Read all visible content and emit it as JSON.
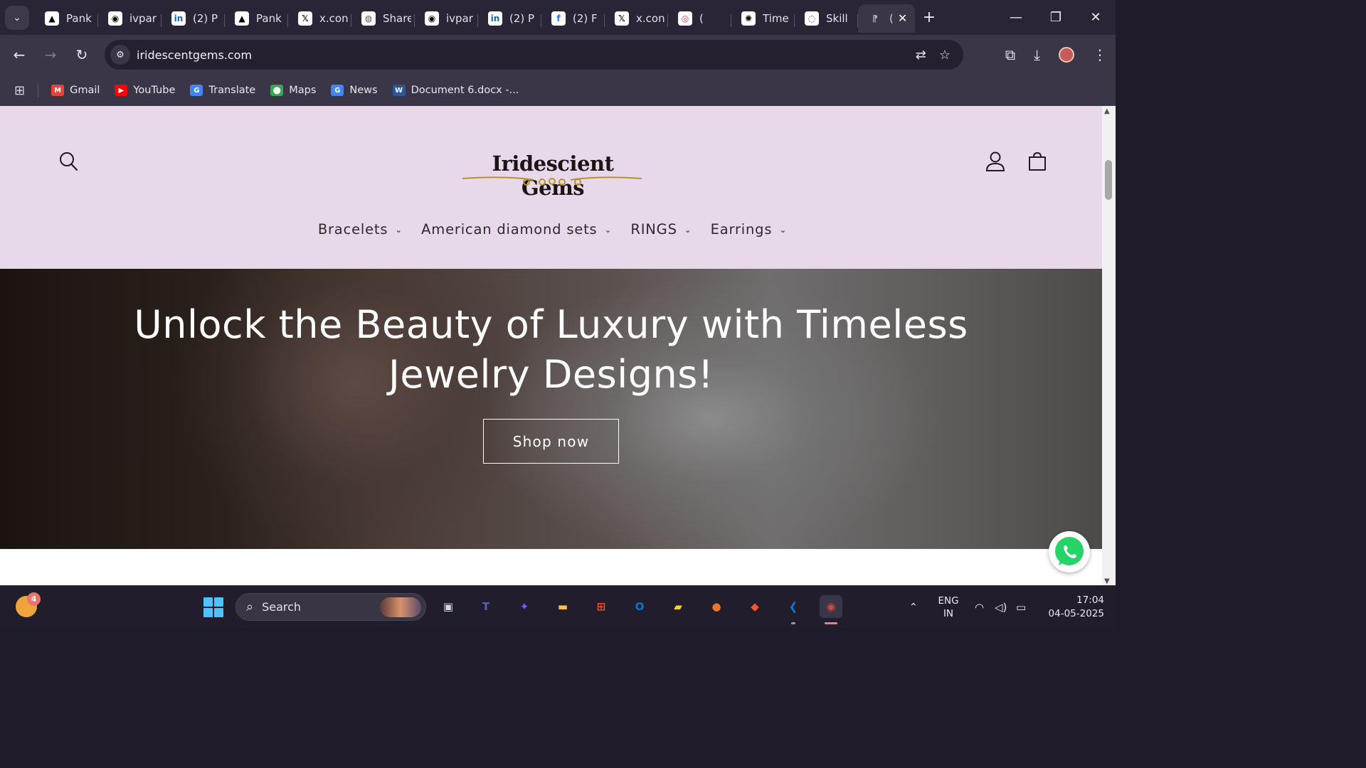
{
  "browser": {
    "tabs": [
      {
        "title": "Pank",
        "icon": "vercel-triangle-icon",
        "fav": "▲",
        "color": "#000000"
      },
      {
        "title": "ivpar",
        "icon": "github-icon",
        "fav": "◉",
        "color": "#000000"
      },
      {
        "title": "(2) P",
        "icon": "linkedin-icon",
        "fav": "in",
        "color": "#0a66c2"
      },
      {
        "title": "Pank",
        "icon": "vercel-triangle-icon",
        "fav": "▲",
        "color": "#000000"
      },
      {
        "title": "x.con",
        "icon": "x-icon",
        "fav": "𝕏",
        "color": "#000000"
      },
      {
        "title": "Share",
        "icon": "globe-icon",
        "fav": "◍",
        "color": "#555555"
      },
      {
        "title": "ivpar",
        "icon": "github-icon",
        "fav": "◉",
        "color": "#000000"
      },
      {
        "title": "(2) P",
        "icon": "linkedin-icon",
        "fav": "in",
        "color": "#0a66c2"
      },
      {
        "title": "(2) F",
        "icon": "facebook-icon",
        "fav": "f",
        "color": "#1877f2"
      },
      {
        "title": "x.con",
        "icon": "x-icon",
        "fav": "𝕏",
        "color": "#000000"
      },
      {
        "title": "(",
        "icon": "instagram-icon",
        "fav": "◎",
        "color": "#e1306c"
      },
      {
        "title": "Time",
        "icon": "chatgpt-icon",
        "fav": "✺",
        "color": "#000000"
      },
      {
        "title": "Skill",
        "icon": "skill-icon",
        "fav": "◌",
        "color": "#444444"
      }
    ],
    "active_tab": {
      "title": "(",
      "icon": "site-favicon-icon"
    },
    "window_controls": {
      "minimize": "—",
      "maximize": "❐",
      "close": "✕"
    },
    "url": "iridescentgems.com",
    "bookmarks": [
      {
        "label": "Gmail",
        "icon": "gmail-icon",
        "glyph": "M",
        "color": "#ea4335"
      },
      {
        "label": "YouTube",
        "icon": "youtube-icon",
        "glyph": "▶",
        "color": "#ff0000"
      },
      {
        "label": "Translate",
        "icon": "google-translate-icon",
        "glyph": "G",
        "color": "#4285f4"
      },
      {
        "label": "Maps",
        "icon": "google-maps-icon",
        "glyph": "⬤",
        "color": "#34a853"
      },
      {
        "label": "News",
        "icon": "google-news-icon",
        "glyph": "G",
        "color": "#4285f4"
      },
      {
        "label": "Document 6.docx -...",
        "icon": "word-icon",
        "glyph": "W",
        "color": "#2b579a"
      }
    ]
  },
  "site": {
    "logo_text": "Iridescient Gems",
    "menu": [
      {
        "label": "Bracelets"
      },
      {
        "label": "American diamond sets"
      },
      {
        "label": "RINGS"
      },
      {
        "label": "Earrings"
      }
    ],
    "hero": {
      "title_line1": "Unlock the Beauty of Luxury with Timeless",
      "title_line2": "Jewelry Designs!",
      "cta": "Shop now"
    }
  },
  "taskbar": {
    "weather_badge": "4",
    "search_placeholder": "Search",
    "apps": [
      {
        "name": "task-view-icon",
        "glyph": "▣",
        "color": "#cfd8e3"
      },
      {
        "name": "teams-icon",
        "glyph": "T",
        "color": "#5b5fc7"
      },
      {
        "name": "copilot-icon",
        "glyph": "✦",
        "color": "#7a5af8"
      },
      {
        "name": "file-explorer-icon",
        "glyph": "▬",
        "color": "#f5c242"
      },
      {
        "name": "microsoft-store-icon",
        "glyph": "⊞",
        "color": "#f25022"
      },
      {
        "name": "outlook-icon",
        "glyph": "O",
        "color": "#0078d4"
      },
      {
        "name": "sticky-notes-icon",
        "glyph": "▰",
        "color": "#f7d51f"
      },
      {
        "name": "app-orange-icon",
        "glyph": "●",
        "color": "#e8762c"
      },
      {
        "name": "brave-icon",
        "glyph": "◆",
        "color": "#fb542b"
      },
      {
        "name": "vscode-icon",
        "glyph": "❮",
        "color": "#0a7cd3"
      },
      {
        "name": "chrome-icon",
        "glyph": "◉",
        "color": "#db4437"
      }
    ],
    "language": {
      "line1": "ENG",
      "line2": "IN"
    },
    "time": "17:04",
    "date": "04-05-2025"
  }
}
